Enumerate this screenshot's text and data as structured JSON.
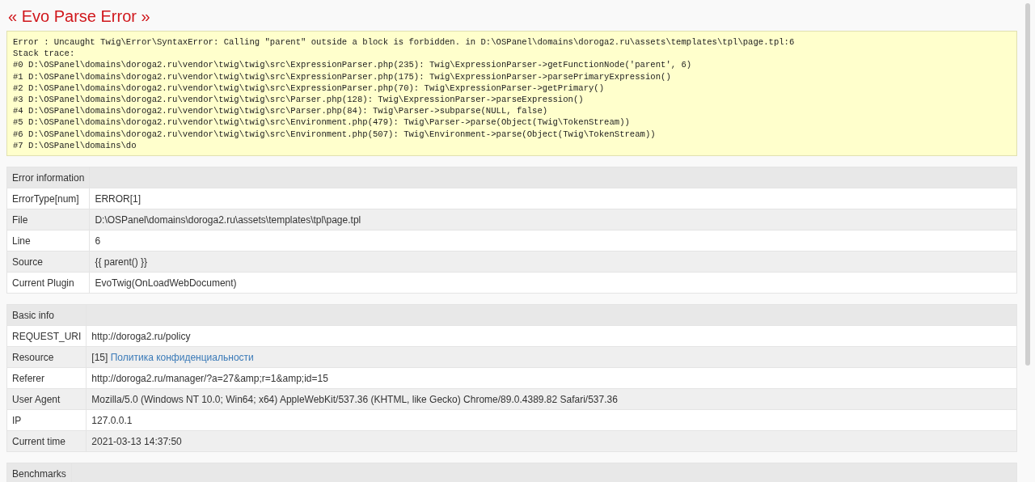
{
  "title": "« Evo Parse Error »",
  "error_lines": [
    "Error : Uncaught Twig\\Error\\SyntaxError: Calling \"parent\" outside a block is forbidden. in D:\\OSPanel\\domains\\doroga2.ru\\assets\\templates\\tpl\\page.tpl:6",
    "Stack trace:",
    "#0 D:\\OSPanel\\domains\\doroga2.ru\\vendor\\twig\\twig\\src\\ExpressionParser.php(235): Twig\\ExpressionParser->getFunctionNode('parent', 6)",
    "#1 D:\\OSPanel\\domains\\doroga2.ru\\vendor\\twig\\twig\\src\\ExpressionParser.php(175): Twig\\ExpressionParser->parsePrimaryExpression()",
    "#2 D:\\OSPanel\\domains\\doroga2.ru\\vendor\\twig\\twig\\src\\ExpressionParser.php(70): Twig\\ExpressionParser->getPrimary()",
    "#3 D:\\OSPanel\\domains\\doroga2.ru\\vendor\\twig\\twig\\src\\Parser.php(128): Twig\\ExpressionParser->parseExpression()",
    "#4 D:\\OSPanel\\domains\\doroga2.ru\\vendor\\twig\\twig\\src\\Parser.php(84): Twig\\Parser->subparse(NULL, false)",
    "#5 D:\\OSPanel\\domains\\doroga2.ru\\vendor\\twig\\twig\\src\\Environment.php(479): Twig\\Parser->parse(Object(Twig\\TokenStream))",
    "#6 D:\\OSPanel\\domains\\doroga2.ru\\vendor\\twig\\twig\\src\\Environment.php(507): Twig\\Environment->parse(Object(Twig\\TokenStream))",
    "#7 D:\\OSPanel\\domains\\do"
  ],
  "tables": [
    {
      "heading": "Error information",
      "rows": [
        {
          "label": "ErrorType[num]",
          "value": "ERROR[1]"
        },
        {
          "label": "File",
          "value": "D:\\OSPanel\\domains\\doroga2.ru\\assets\\templates\\tpl\\page.tpl"
        },
        {
          "label": "Line",
          "value": "6"
        },
        {
          "label": "Source",
          "value": "{{ parent() }}"
        },
        {
          "label": "Current Plugin",
          "value": "EvoTwig(OnLoadWebDocument)"
        }
      ]
    },
    {
      "heading": "Basic info",
      "rows": [
        {
          "label": "REQUEST_URI",
          "value": "http://doroga2.ru/policy"
        },
        {
          "label": "Resource",
          "value": "[15]",
          "link": "Политика конфиденциальности"
        },
        {
          "label": "Referer",
          "value": "http://doroga2.ru/manager/?a=27&amp;r=1&amp;id=15"
        },
        {
          "label": "User Agent",
          "value": "Mozilla/5.0 (Windows NT 10.0; Win64; x64) AppleWebKit/537.36 (KHTML, like Gecko) Chrome/89.0.4389.82 Safari/537.36"
        },
        {
          "label": "IP",
          "value": "127.0.0.1"
        },
        {
          "label": "Current time",
          "value": "2021-03-13 14:37:50"
        }
      ]
    },
    {
      "heading": "Benchmarks"
    }
  ]
}
